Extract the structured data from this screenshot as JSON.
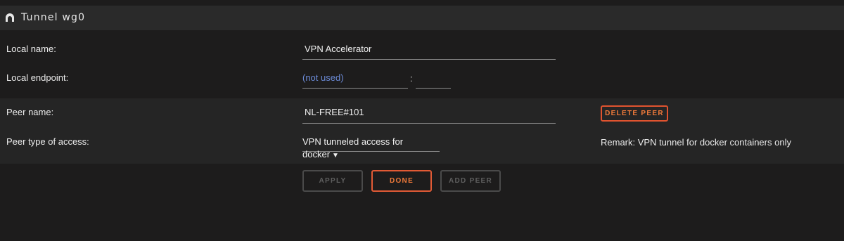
{
  "header": {
    "title": "Tunnel wg0",
    "icon": "tunnel-icon"
  },
  "local": {
    "name_label": "Local name:",
    "name_value": "VPN Accelerator",
    "endpoint_label": "Local endpoint:",
    "endpoint_value": "(not used)",
    "endpoint_separator": ":",
    "endpoint_port": ""
  },
  "peer": {
    "name_label": "Peer name:",
    "name_value": "NL-FREE#101",
    "delete_label": "DELETE PEER",
    "access_label": "Peer type of access:",
    "access_value": "VPN tunneled access for docker",
    "access_arrow": "▼",
    "remark": "Remark: VPN tunnel for docker containers only"
  },
  "buttons": {
    "apply": "APPLY",
    "done": "DONE",
    "add_peer": "ADD PEER"
  },
  "colors": {
    "accent": "#e25a35",
    "accent_text": "#f07a3a",
    "placeholder": "#6b8ad6",
    "disabled": "#4a4a4a"
  }
}
